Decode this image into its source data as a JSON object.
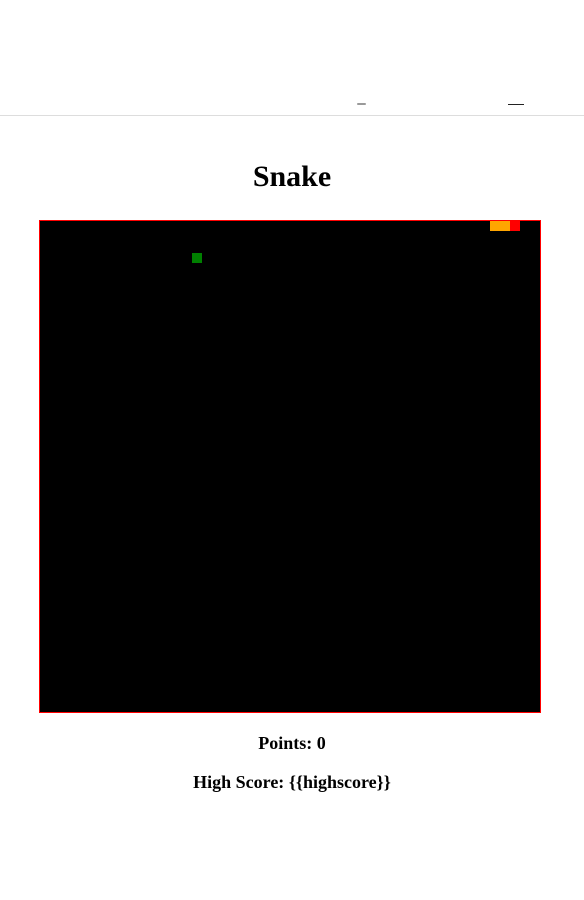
{
  "game": {
    "title": "Snake",
    "points_label": "Points:",
    "points_value": "0",
    "highscore_label": "High Score:",
    "highscore_value": "{{highscore}}"
  },
  "board": {
    "grid_cols": 50,
    "grid_rows": 49,
    "background_color": "#000000",
    "border_color": "#ff0000",
    "snake": {
      "color": "#ffa500",
      "head_color": "#ff0000",
      "segments": [
        [
          45,
          0
        ],
        [
          46,
          0
        ],
        [
          47,
          0
        ]
      ]
    },
    "food": {
      "color": "#008000",
      "cell": [
        15,
        3
      ]
    }
  }
}
